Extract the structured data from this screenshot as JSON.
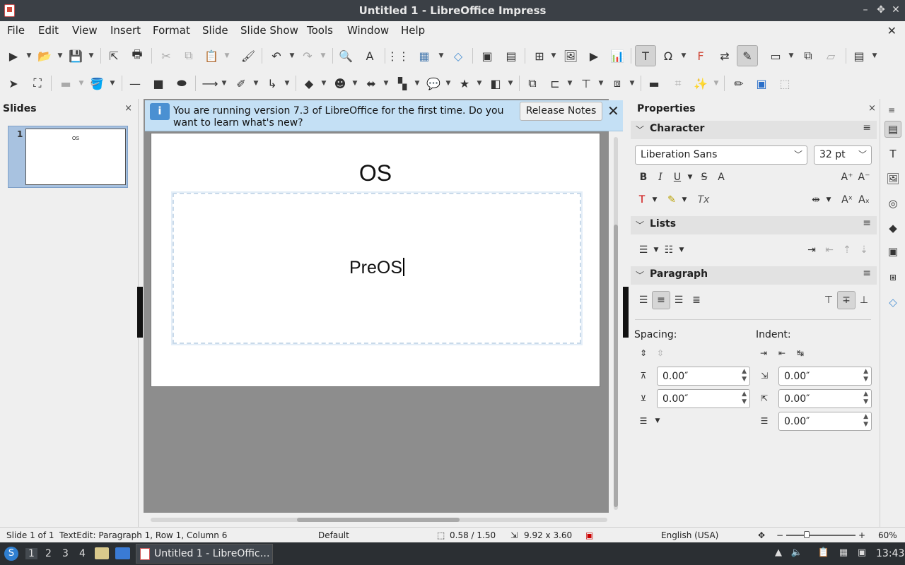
{
  "window": {
    "title": "Untitled 1 - LibreOffice Impress",
    "minimize": "–",
    "maximize": "✥",
    "close": "✕"
  },
  "menubar": {
    "items": [
      "File",
      "Edit",
      "View",
      "Insert",
      "Format",
      "Slide",
      "Slide Show",
      "Tools",
      "Window",
      "Help"
    ],
    "close": "✕"
  },
  "slides_panel": {
    "title": "Slides",
    "close": "×",
    "thumbs": [
      {
        "number": "1",
        "text": "OS"
      }
    ]
  },
  "infobar": {
    "message": "You are running version 7.3 of LibreOffice for the first time. Do you want to learn what's new?",
    "button": "Release Notes",
    "close": "✕",
    "icon": "i"
  },
  "slide": {
    "title": "OS",
    "body": "PreOS"
  },
  "properties": {
    "title": "Properties",
    "close": "×",
    "menu": "≡",
    "character": {
      "label": "Character",
      "font": "Liberation Sans",
      "size": "32 pt"
    },
    "lists": {
      "label": "Lists"
    },
    "paragraph": {
      "label": "Paragraph",
      "spacing_label": "Spacing:",
      "indent_label": "Indent:",
      "spacing_above": "0.00″",
      "spacing_below": "0.00″",
      "indent_before": "0.00″",
      "indent_after": "0.00″",
      "indent_first": "0.00″"
    }
  },
  "statusbar": {
    "slide": "Slide 1 of 1",
    "edit": "TextEdit: Paragraph 1, Row 1, Column 6",
    "layout": "Default",
    "position": "0.58 / 1.50",
    "size": "9.92 x 3.60",
    "language": "English (USA)",
    "zoom": "60%",
    "zoom_level": 0.6
  },
  "taskbar": {
    "workspaces": [
      "1",
      "2",
      "3",
      "4"
    ],
    "active_task": "Untitled 1 - LibreOffic…",
    "clock": "13:43"
  }
}
